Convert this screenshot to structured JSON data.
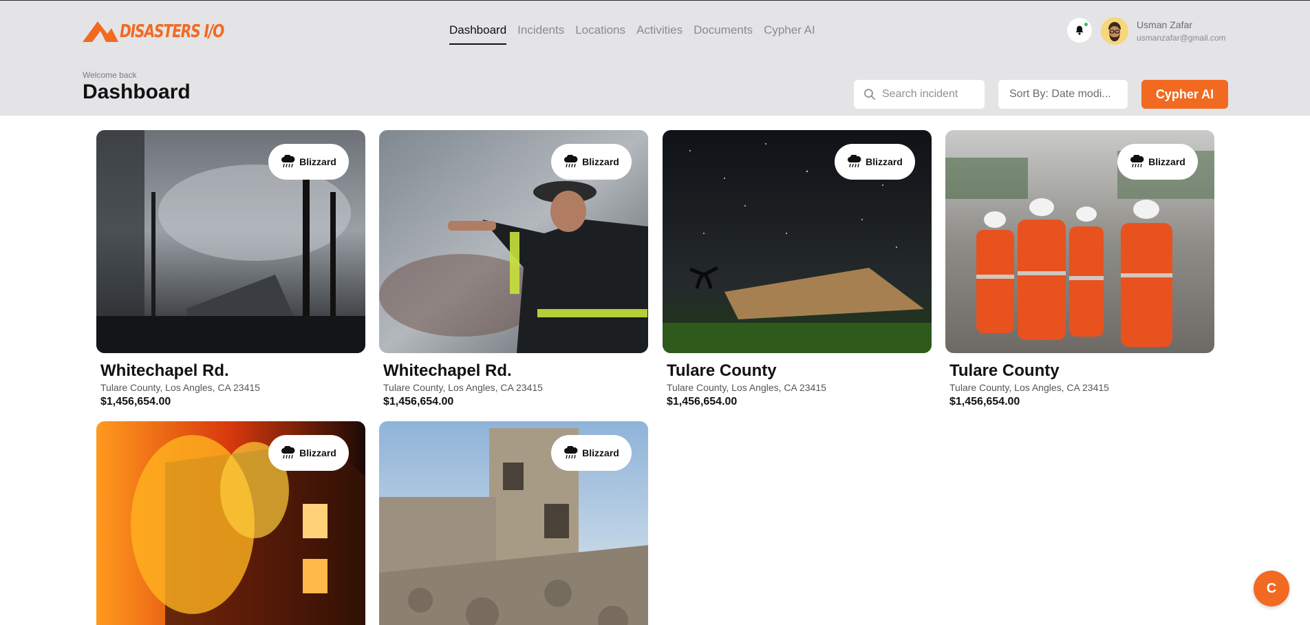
{
  "brand": {
    "logo_text": "DISASTERS I/O",
    "accent": "#f26a21"
  },
  "nav": {
    "items": [
      {
        "label": "Dashboard",
        "active": true
      },
      {
        "label": "Incidents",
        "active": false
      },
      {
        "label": "Locations",
        "active": false
      },
      {
        "label": "Activities",
        "active": false
      },
      {
        "label": "Documents",
        "active": false
      },
      {
        "label": "Cypher AI",
        "active": false
      }
    ]
  },
  "user": {
    "name": "Usman Zafar",
    "email": "usmanzafar@gmail.com",
    "notification_icon": "bell-icon",
    "has_notification": true
  },
  "page": {
    "welcome": "Welcome back",
    "title": "Dashboard"
  },
  "toolbar": {
    "search_placeholder": "Search incident",
    "sort_label": "Sort By: Date modi...",
    "cta_label": "Cypher AI"
  },
  "cards": [
    {
      "title": "Whitechapel Rd.",
      "address": "Tulare County, Los Angles, CA 23415",
      "price": "$1,456,654.00",
      "badge": "Blizzard",
      "badge_icon": "cloud-rain-icon"
    },
    {
      "title": "Whitechapel Rd.",
      "address": "Tulare County, Los Angles, CA 23415",
      "price": "$1,456,654.00",
      "badge": "Blizzard",
      "badge_icon": "cloud-rain-icon"
    },
    {
      "title": "Tulare County",
      "address": "Tulare County, Los Angles, CA 23415",
      "price": "$1,456,654.00",
      "badge": "Blizzard",
      "badge_icon": "cloud-rain-icon"
    },
    {
      "title": "Tulare County",
      "address": "Tulare County, Los Angles, CA 23415",
      "price": "$1,456,654.00",
      "badge": "Blizzard",
      "badge_icon": "cloud-rain-icon"
    },
    {
      "title": "",
      "address": "",
      "price": "",
      "badge": "Blizzard",
      "badge_icon": "cloud-rain-icon"
    },
    {
      "title": "",
      "address": "",
      "price": "",
      "badge": "Blizzard",
      "badge_icon": "cloud-rain-icon"
    }
  ],
  "fab": {
    "label": "C"
  }
}
